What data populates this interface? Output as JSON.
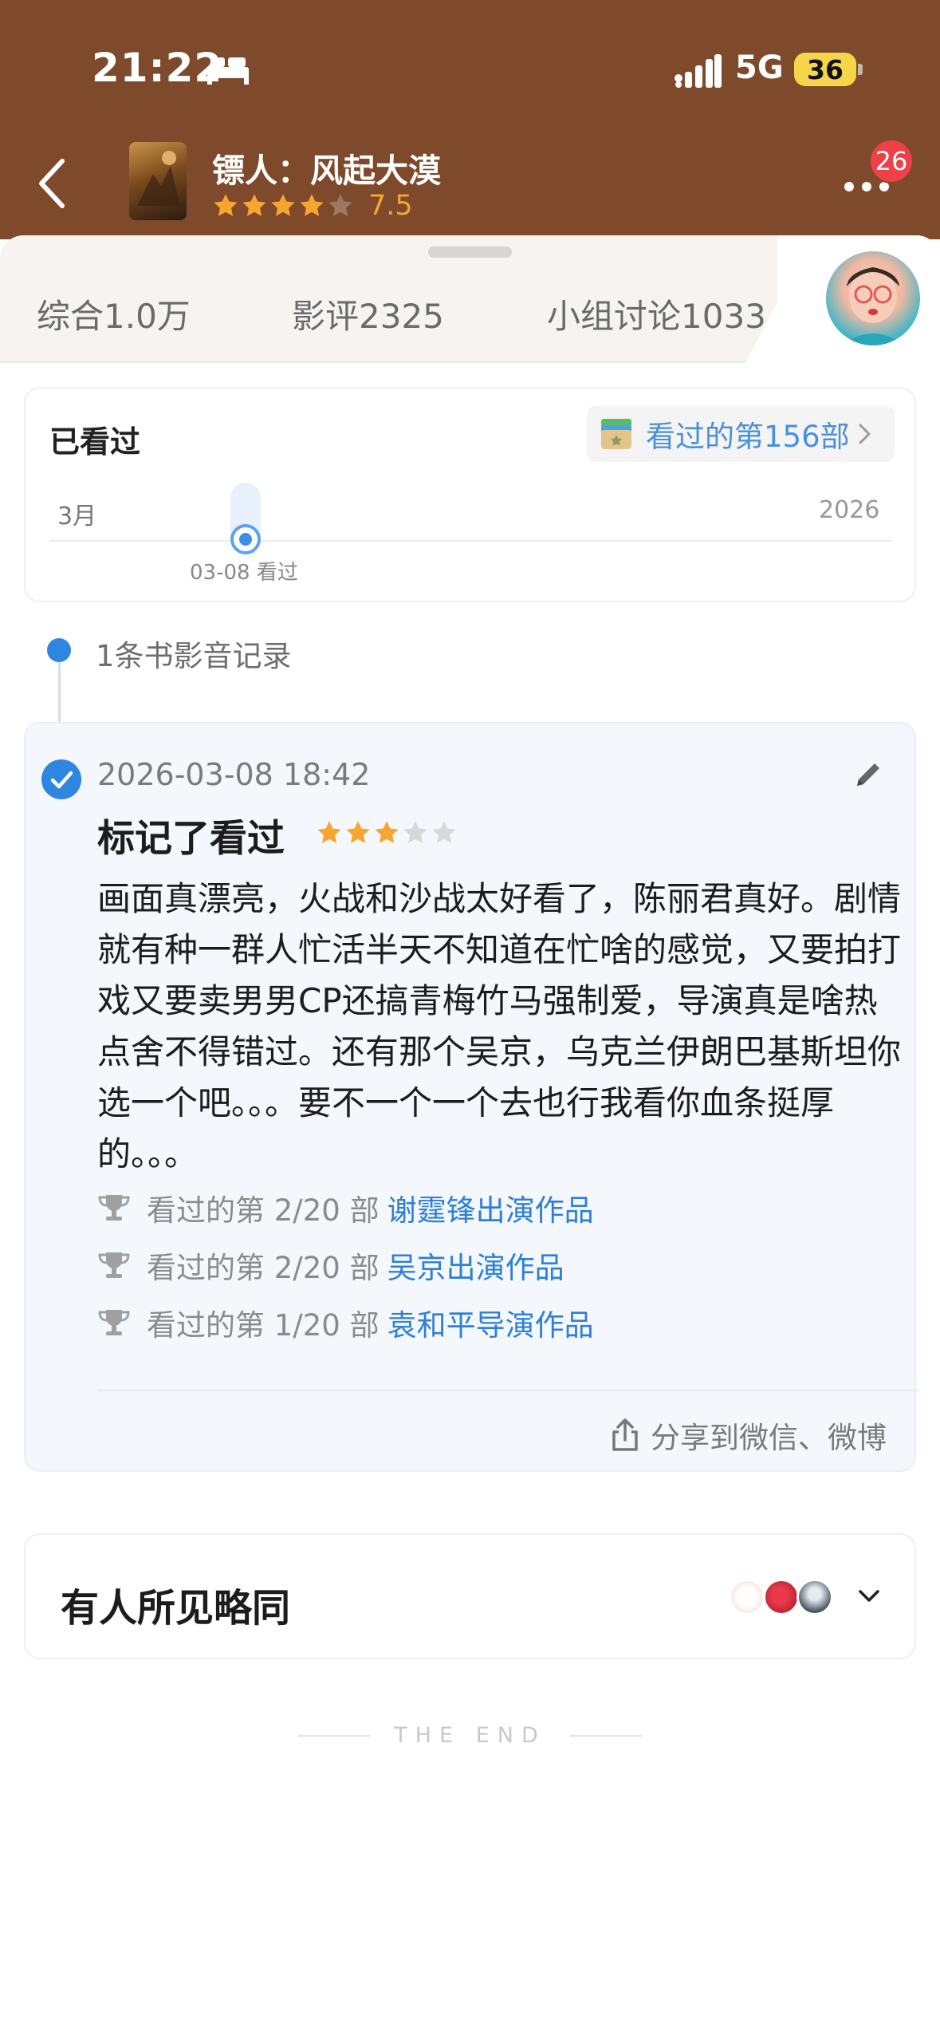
{
  "status_bar": {
    "time": "21:22",
    "network": "5G",
    "battery": "36",
    "icons": [
      "bed-icon",
      "signal-icon"
    ]
  },
  "header": {
    "title": "镖人：风起大漠",
    "rating": "7.5",
    "rating_stars": 4,
    "notification_count": "26",
    "colors": {
      "header_bg": "#7e4a2b",
      "star": "#f7a531"
    }
  },
  "tabs": [
    {
      "label": "综合1.0万"
    },
    {
      "label": "影评2325"
    },
    {
      "label": "小组讨论1033"
    }
  ],
  "watched": {
    "title": "已看过",
    "count_label": "看过的第156部",
    "timeline_start": "3月",
    "timeline_end": "2026",
    "marker_label": "03-08 看过"
  },
  "record": {
    "label": "1条书影音记录"
  },
  "review": {
    "datetime": "2026-03-08 18:42",
    "action": "标记了看过",
    "stars": 3,
    "max_stars": 5,
    "text": "画面真漂亮，火战和沙战太好看了，陈丽君真好。剧情就有种一群人忙活半天不知道在忙啥的感觉，又要拍打戏又要卖男男CP还搞青梅竹马强制爱，导演真是啥热点舍不得错过。还有那个吴京，乌克兰伊朗巴基斯坦你选一个吧。。。要不一个一个去也行我看你血条挺厚的。。。",
    "works": [
      {
        "prefix": "看过的第 2/20 部",
        "link": "谢霆锋出演作品"
      },
      {
        "prefix": "看过的第 2/20 部",
        "link": "吴京出演作品"
      },
      {
        "prefix": "看过的第 1/20 部",
        "link": "袁和平导演作品"
      }
    ],
    "share_label": "分享到微信、微博",
    "colors": {
      "accent": "#2e86e0",
      "star_on": "#f7a531",
      "star_off": "#d8d8d8"
    }
  },
  "similar": {
    "title": "有人所见略同"
  },
  "footer": {
    "end_text": "THE END"
  }
}
